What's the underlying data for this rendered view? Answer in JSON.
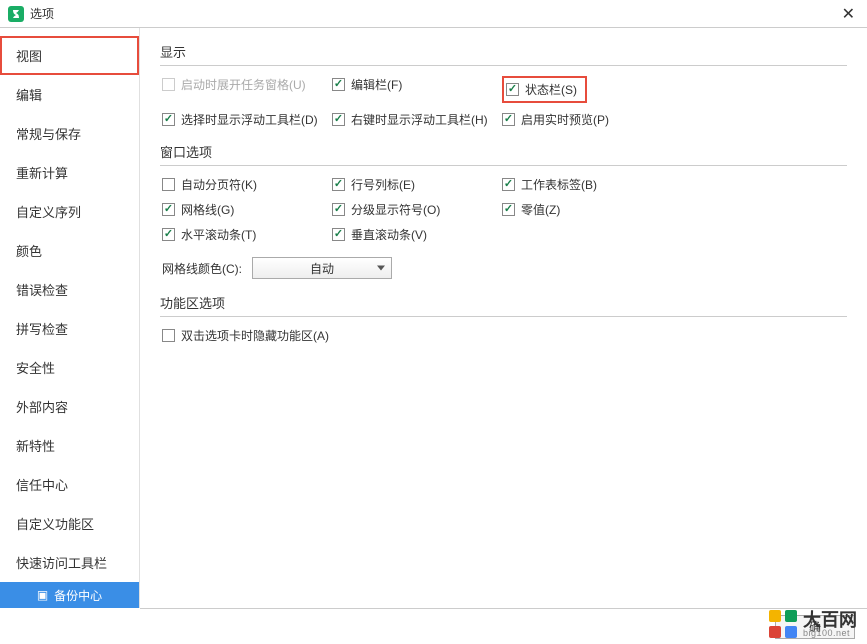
{
  "titlebar": {
    "title": "选项"
  },
  "sidebar": {
    "items": [
      {
        "label": "视图",
        "active": true
      },
      {
        "label": "编辑"
      },
      {
        "label": "常规与保存"
      },
      {
        "label": "重新计算"
      },
      {
        "label": "自定义序列"
      },
      {
        "label": "颜色"
      },
      {
        "label": "错误检查"
      },
      {
        "label": "拼写检查"
      },
      {
        "label": "安全性"
      },
      {
        "label": "外部内容"
      },
      {
        "label": "新特性"
      },
      {
        "label": "信任中心"
      },
      {
        "label": "自定义功能区"
      },
      {
        "label": "快速访问工具栏"
      }
    ],
    "backup_label": "备份中心"
  },
  "sections": {
    "display": {
      "title": "显示",
      "items": [
        {
          "label": "启动时展开任务窗格(U)",
          "checked": false,
          "disabled": true
        },
        {
          "label": "编辑栏(F)",
          "checked": true
        },
        {
          "label": "状态栏(S)",
          "checked": true,
          "highlight": true
        },
        {
          "label": "选择时显示浮动工具栏(D)",
          "checked": true
        },
        {
          "label": "右键时显示浮动工具栏(H)",
          "checked": true
        },
        {
          "label": "启用实时预览(P)",
          "checked": true
        }
      ]
    },
    "window": {
      "title": "窗口选项",
      "items": [
        {
          "label": "自动分页符(K)",
          "checked": false
        },
        {
          "label": "行号列标(E)",
          "checked": true
        },
        {
          "label": "工作表标签(B)",
          "checked": true
        },
        {
          "label": "网格线(G)",
          "checked": true
        },
        {
          "label": "分级显示符号(O)",
          "checked": true
        },
        {
          "label": "零值(Z)",
          "checked": true
        },
        {
          "label": "水平滚动条(T)",
          "checked": true
        },
        {
          "label": "垂直滚动条(V)",
          "checked": true
        }
      ],
      "grid_color_label": "网格线颜色(C):",
      "grid_color_value": "自动"
    },
    "ribbon": {
      "title": "功能区选项",
      "items": [
        {
          "label": "双击选项卡时隐藏功能区(A)",
          "checked": false
        }
      ]
    }
  },
  "footer": {
    "ok": "确"
  },
  "watermark": {
    "big": "大百网",
    "small": "big100.net"
  }
}
